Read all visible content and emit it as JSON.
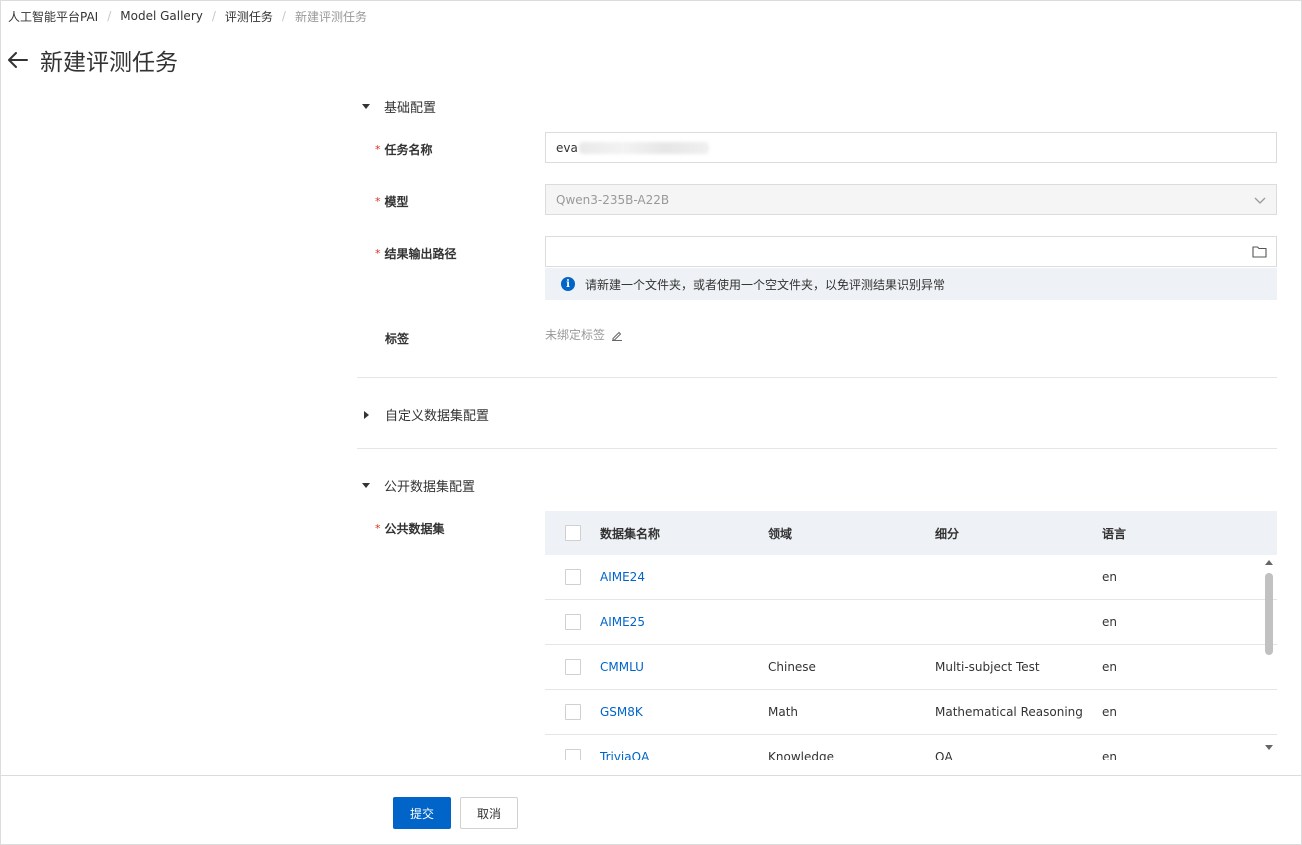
{
  "breadcrumb": {
    "items": [
      "人工智能平台PAI",
      "Model Gallery",
      "评测任务",
      "新建评测任务"
    ]
  },
  "page": {
    "title": "新建评测任务"
  },
  "sections": {
    "basic": {
      "title": "基础配置"
    },
    "custom_dataset": {
      "title": "自定义数据集配置"
    },
    "public_dataset": {
      "title": "公开数据集配置"
    }
  },
  "form": {
    "task_name": {
      "label": "任务名称",
      "value": "eva"
    },
    "model": {
      "label": "模型",
      "value": "Qwen3-235B-A22B"
    },
    "output_path": {
      "label": "结果输出路径",
      "value": ""
    },
    "notice": "请新建一个文件夹，或者使用一个空文件夹，以免评测结果识别异常",
    "tags": {
      "label": "标签",
      "value": "未绑定标签"
    },
    "public_dataset": {
      "label": "公共数据集"
    }
  },
  "table": {
    "headers": [
      "数据集名称",
      "领域",
      "细分",
      "语言"
    ],
    "rows": [
      {
        "name": "AIME24",
        "domain": "",
        "subdomain": "",
        "lang": "en"
      },
      {
        "name": "AIME25",
        "domain": "",
        "subdomain": "",
        "lang": "en"
      },
      {
        "name": "CMMLU",
        "domain": "Chinese",
        "subdomain": "Multi-subject Test",
        "lang": "en"
      },
      {
        "name": "GSM8K",
        "domain": "Math",
        "subdomain": "Mathematical Reasoning",
        "lang": "en"
      },
      {
        "name": "TriviaQA",
        "domain": "Knowledge",
        "subdomain": "QA",
        "lang": "en"
      }
    ]
  },
  "footer": {
    "submit_label": "提交",
    "cancel_label": "取消"
  },
  "colors": {
    "primary": "#0064c8",
    "required": "#d93026",
    "notice_bg": "#eef1f5"
  }
}
